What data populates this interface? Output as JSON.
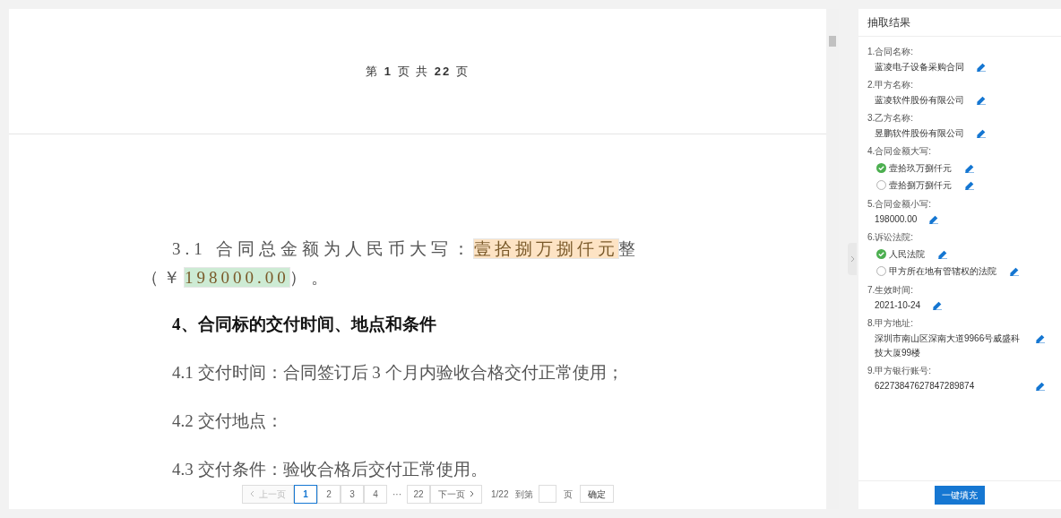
{
  "document": {
    "page_header": "第 **1** 页 共 **22** 页",
    "paragraphs": [
      {
        "kind": "justified",
        "parts": [
          {
            "text": "3.1 合同总金额为人民币大写："
          },
          {
            "text": "壹拾捌万捌仟元",
            "color": "#fde3c4"
          },
          {
            "text": "整（￥"
          },
          {
            "text": "198000.00",
            "color": "#cdebd4"
          },
          {
            "text": "）。"
          }
        ]
      },
      {
        "kind": "heading",
        "parts": [
          {
            "text": "4、合同标的交付时间、地点和条件"
          }
        ]
      },
      {
        "kind": "body",
        "parts": [
          {
            "text": "4.1 交付时间：合同签订后 3 个月内验收合格交付正常使用；"
          }
        ]
      },
      {
        "kind": "body",
        "parts": [
          {
            "text": "4.2 交付地点："
          }
        ]
      },
      {
        "kind": "body",
        "parts": [
          {
            "text": "4.3 交付条件：验收合格后交付正常使用。"
          }
        ]
      }
    ]
  },
  "pagination": {
    "prev": "上一页",
    "prev_disabled": true,
    "pages": [
      {
        "label": "1",
        "selected": true
      },
      {
        "label": "2",
        "selected": false
      },
      {
        "label": "3",
        "selected": false
      },
      {
        "label": "4",
        "selected": false
      },
      {
        "label": "···",
        "kind": "ellipsis"
      },
      {
        "label": "22",
        "selected": false
      }
    ],
    "next": "下一页",
    "count": "1/22",
    "goto_label": "到第",
    "goto_unit": "页",
    "confirm": "确定"
  },
  "results": {
    "title": "抽取结果",
    "fields": [
      {
        "label": "1.合同名称:",
        "kind": "text",
        "value": "蓝凌电子设备采购合同"
      },
      {
        "label": "2.甲方名称:",
        "kind": "text",
        "value": "蓝凌软件股份有限公司"
      },
      {
        "label": "3.乙方名称:",
        "kind": "text",
        "value": "昱鹏软件股份有限公司"
      },
      {
        "label": "4.合同金额大写:",
        "kind": "options",
        "options": [
          {
            "value": "壹拾玖万捌仟元",
            "selected": true
          },
          {
            "value": "壹拾捌万捌仟元",
            "selected": false
          }
        ]
      },
      {
        "label": "5.合同金额小写:",
        "kind": "text",
        "value": "198000.00"
      },
      {
        "label": "6.诉讼法院:",
        "kind": "options",
        "options": [
          {
            "value": "人民法院",
            "selected": true
          },
          {
            "value": "甲方所在地有管辖权的法院",
            "selected": false
          }
        ]
      },
      {
        "label": "7.生效时间:",
        "kind": "text",
        "value": "2021-10-24"
      },
      {
        "label": "8.甲方地址:",
        "kind": "text",
        "value": "深圳市南山区深南大道9966号威盛科技大厦99楼"
      },
      {
        "label": "9.甲方银行账号:",
        "kind": "text",
        "value": "62273847627847289874"
      }
    ],
    "fill_button": "一键填充"
  }
}
